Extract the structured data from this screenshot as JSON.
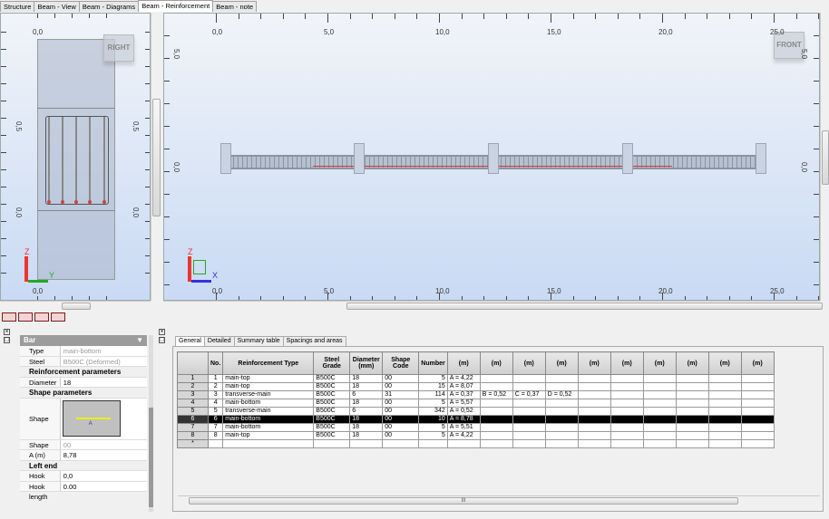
{
  "tabs": [
    {
      "label": "Structure",
      "active": false
    },
    {
      "label": "Beam - View",
      "active": false
    },
    {
      "label": "Beam - Diagrams",
      "active": false
    },
    {
      "label": "Beam - Reinforcement",
      "active": true
    },
    {
      "label": "Beam - note",
      "active": false
    }
  ],
  "side_view": {
    "nav_cube": "RIGHT",
    "top_label": "0,0",
    "bottom_label": "0,0",
    "left_labels": [
      "0,5",
      "0,0"
    ],
    "right_labels": [
      "0,5",
      "0,0"
    ],
    "axis_z": "Z",
    "axis_y": "Y"
  },
  "front_view": {
    "nav_cube": "FRONT",
    "x_labels": [
      "0,0",
      "5,0",
      "10,0",
      "15,0",
      "20,0",
      "25,0"
    ],
    "left_labels": [
      "5,0",
      "0,0"
    ],
    "right_labels": [
      "5,0",
      "0,0"
    ],
    "axis_z": "Z",
    "axis_x": "X"
  },
  "toolbar": [
    "bars-view-icon",
    "stirrup-view-icon",
    "columns-view-icon",
    "section-view-icon"
  ],
  "properties": {
    "title": "Bar",
    "rows": [
      {
        "type": "row",
        "key": "Type",
        "value": "main-bottom",
        "gray": true
      },
      {
        "type": "row",
        "key": "Steel",
        "value": "B500C (Deformed)",
        "gray": true
      },
      {
        "type": "head",
        "label": "Reinforcement parameters"
      },
      {
        "type": "row",
        "key": "Diameter",
        "value": "18"
      },
      {
        "type": "head",
        "label": "Shape parameters"
      },
      {
        "type": "shape",
        "key": "Shape",
        "value": "A"
      },
      {
        "type": "row",
        "key": "Shape code",
        "value": "00",
        "gray": true
      },
      {
        "type": "row",
        "key": "A (m)",
        "value": "8,78"
      },
      {
        "type": "head",
        "label": "Left end"
      },
      {
        "type": "row",
        "key": "Hook",
        "value": "0,0"
      },
      {
        "type": "row",
        "key": "Hook length",
        "value": "0.00"
      }
    ]
  },
  "grid_tabs": [
    {
      "label": "General",
      "active": true
    },
    {
      "label": "Detailed",
      "active": false
    },
    {
      "label": "Summary table",
      "active": false
    },
    {
      "label": "Spacings and areas",
      "active": false
    }
  ],
  "grid": {
    "headers": [
      "No.",
      "Reinforcement Type",
      "Steel Grade",
      "Diameter (mm)",
      "Shape Code",
      "Number",
      "(m)",
      "(m)",
      "(m)",
      "(m)",
      "(m)",
      "(m)",
      "(m)",
      "(m)",
      "(m)",
      "(m)"
    ],
    "rows": [
      {
        "rh": "1",
        "no": "1",
        "type": "main-top",
        "grade": "B500C",
        "dia": "18",
        "code": "00",
        "num": "5",
        "dims": [
          "A = 4,22",
          "",
          "",
          "",
          "",
          "",
          "",
          "",
          "",
          ""
        ]
      },
      {
        "rh": "2",
        "no": "2",
        "type": "main-top",
        "grade": "B500C",
        "dia": "18",
        "code": "00",
        "num": "15",
        "dims": [
          "A = 8,07",
          "",
          "",
          "",
          "",
          "",
          "",
          "",
          "",
          ""
        ]
      },
      {
        "rh": "3",
        "no": "3",
        "type": "transverse-main",
        "grade": "B500C",
        "dia": "6",
        "code": "31",
        "num": "114",
        "dims": [
          "A = 0,37",
          "B = 0,52",
          "C = 0,37",
          "D = 0,52",
          "",
          "",
          "",
          "",
          "",
          ""
        ]
      },
      {
        "rh": "4",
        "no": "4",
        "type": "main-bottom",
        "grade": "B500C",
        "dia": "18",
        "code": "00",
        "num": "5",
        "dims": [
          "A = 5,57",
          "",
          "",
          "",
          "",
          "",
          "",
          "",
          "",
          ""
        ]
      },
      {
        "rh": "5",
        "no": "5",
        "type": "transverse-main",
        "grade": "B500C",
        "dia": "6",
        "code": "00",
        "num": "342",
        "dims": [
          "A = 0,52",
          "",
          "",
          "",
          "",
          "",
          "",
          "",
          "",
          ""
        ]
      },
      {
        "rh": "6",
        "no": "6",
        "type": "main-bottom",
        "grade": "B500C",
        "dia": "18",
        "code": "00",
        "num": "10",
        "dims": [
          "A = 8,78",
          "",
          "",
          "",
          "",
          "",
          "",
          "",
          "",
          ""
        ],
        "selected": true
      },
      {
        "rh": "7",
        "no": "7",
        "type": "main-bottom",
        "grade": "B500C",
        "dia": "18",
        "code": "00",
        "num": "5",
        "dims": [
          "A = 5,51",
          "",
          "",
          "",
          "",
          "",
          "",
          "",
          "",
          ""
        ]
      },
      {
        "rh": "8",
        "no": "8",
        "type": "main-top",
        "grade": "B500C",
        "dia": "18",
        "code": "00",
        "num": "5",
        "dims": [
          "A = 4,22",
          "",
          "",
          "",
          "",
          "",
          "",
          "",
          "",
          ""
        ]
      },
      {
        "rh": "*",
        "no": "",
        "type": "",
        "grade": "",
        "dia": "",
        "code": "",
        "num": "",
        "dims": [
          "",
          "",
          "",
          "",
          "",
          "",
          "",
          "",
          "",
          ""
        ]
      }
    ]
  }
}
